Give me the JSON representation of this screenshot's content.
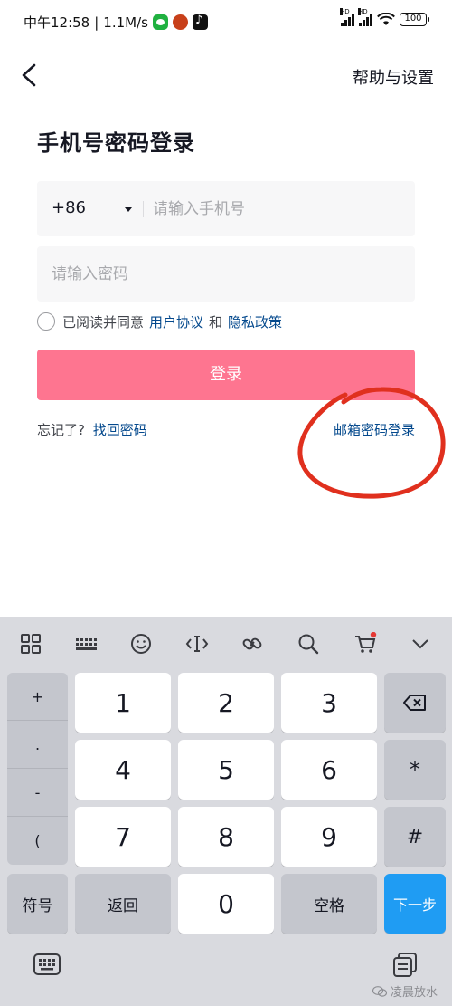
{
  "status_bar": {
    "time": "中午12:58",
    "net_speed": "1.1M/s",
    "separator": "|",
    "battery": "100",
    "hd_label": "HD"
  },
  "header": {
    "help_label": "帮助与设置"
  },
  "page_title": "手机号密码登录",
  "phone": {
    "country_code": "+86",
    "placeholder": "请输入手机号",
    "value": ""
  },
  "password": {
    "placeholder": "请输入密码",
    "value": ""
  },
  "agreement": {
    "prefix": "已阅读并同意",
    "user_agreement": "用户协议",
    "and": "和",
    "privacy_policy": "隐私政策"
  },
  "login_button": "登录",
  "forgot": {
    "prefix": "忘记了?",
    "link": "找回密码"
  },
  "email_login": "邮箱密码登录",
  "keyboard": {
    "symbols": [
      "+",
      ".",
      "-",
      "("
    ],
    "digits": [
      "1",
      "2",
      "3",
      "4",
      "5",
      "6",
      "7",
      "8",
      "9",
      "0"
    ],
    "star": "*",
    "hash": "#",
    "sym_label": "符号",
    "back_label": "返回",
    "space_label": "空格",
    "next_label": "下一步"
  },
  "watermark": "凌晨放水",
  "colors": {
    "login_button": "#fe7590",
    "link": "#04498d",
    "annotation": "#e0301e",
    "next_key": "#1f9cf3"
  }
}
